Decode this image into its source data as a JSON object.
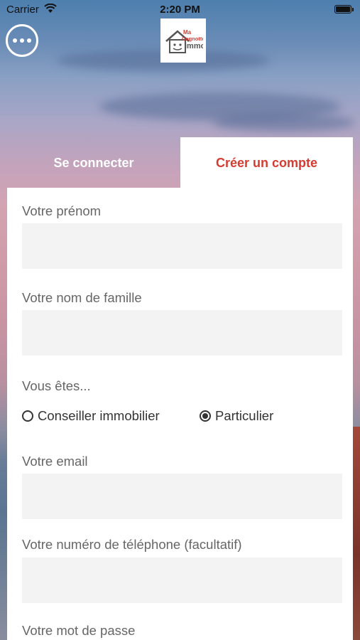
{
  "status_bar": {
    "carrier": "Carrier",
    "time": "2:20 PM"
  },
  "header": {
    "logo_alt": "Ma Cagnotte immo",
    "logo_line1": "Ma",
    "logo_line2": "Cagnotte",
    "logo_line3": "immo"
  },
  "tabs": [
    {
      "label": "Se connecter",
      "active": false
    },
    {
      "label": "Créer un compte",
      "active": true
    }
  ],
  "form": {
    "first_name_label": "Votre prénom",
    "first_name_value": "",
    "last_name_label": "Votre nom de famille",
    "last_name_value": "",
    "role_label": "Vous êtes...",
    "role_options": [
      {
        "label": "Conseiller immobilier",
        "selected": false
      },
      {
        "label": "Particulier",
        "selected": true
      }
    ],
    "email_label": "Votre email",
    "email_value": "",
    "phone_label": "Votre numéro de téléphone (facultatif)",
    "phone_value": "",
    "password_label": "Votre mot de passe"
  },
  "colors": {
    "accent": "#d33c32",
    "field_bg": "#f3f3f3"
  }
}
